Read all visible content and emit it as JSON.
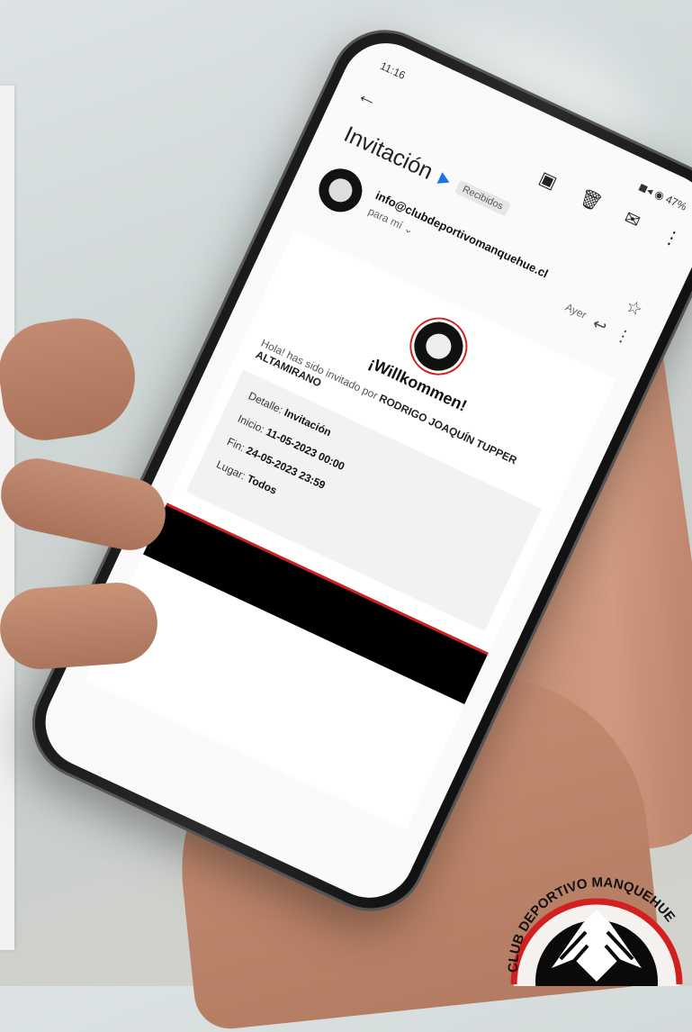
{
  "status": {
    "time": "11:16",
    "system": "◼◂ ◉ 47%"
  },
  "email": {
    "subject": "Invitación",
    "label": "Recibidos",
    "sender": "info@clubdeportivomanquehue.cl",
    "recipient": "para mí",
    "date": "Ayer",
    "welcome": "¡Willkommen!",
    "intro": "Hola! has sido invitado por",
    "inviter": "RODRIGO JOAQUÍN TUPPER ALTAMIRANO",
    "details": {
      "detalle_label": "Detalle:",
      "detalle_value": "Invitación",
      "inicio_label": "Inicio:",
      "inicio_value": "11-05-2023 00:00",
      "fin_label": "Fin:",
      "fin_value": "24-05-2023 23:59",
      "lugar_label": "Lugar:",
      "lugar_value": "Todos"
    }
  },
  "logo": {
    "text": "CLUB DEPORTIVO MANQUEHUE"
  },
  "colors": {
    "accent": "#d21f1f",
    "link": "#1a73e8"
  }
}
